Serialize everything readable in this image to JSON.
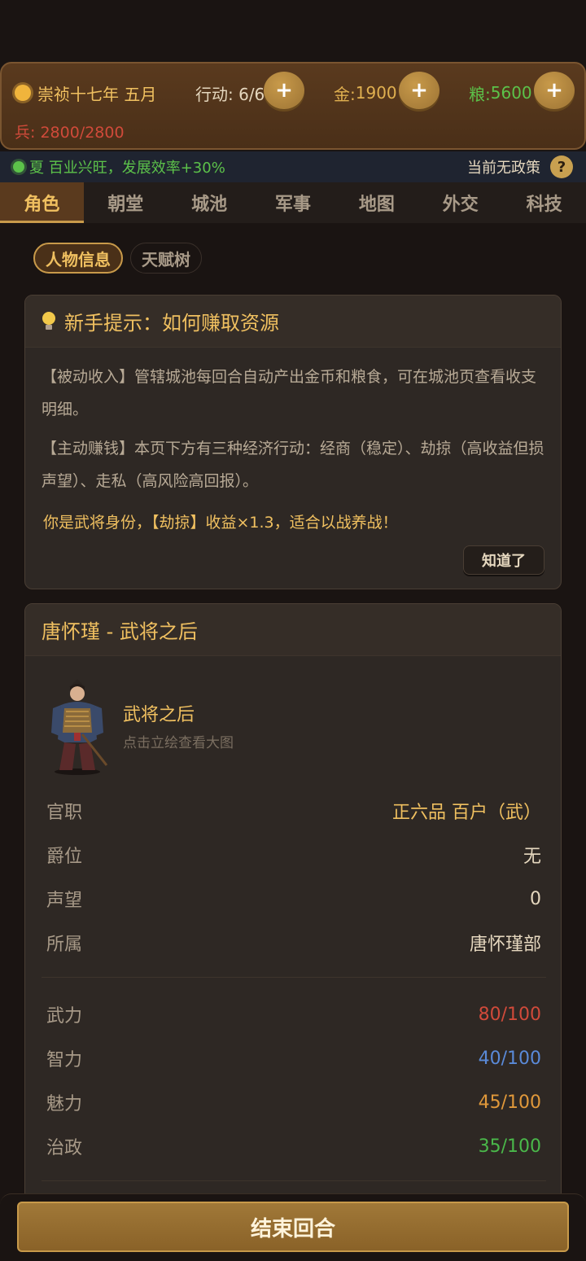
{
  "resources": {
    "date": "崇祯十七年 五月",
    "actions": "行动: 6/6",
    "gold_label": "金: ",
    "gold_value": "1900",
    "grain_label": "粮: ",
    "grain_value": "5600",
    "plus": "+",
    "soldiers": "兵: 2800/2800"
  },
  "season": {
    "text": "夏 百业兴旺，发展效率+30%",
    "policy": "当前无政策",
    "help": "?"
  },
  "tabs": [
    {
      "label": "角色"
    },
    {
      "label": "朝堂"
    },
    {
      "label": "城池"
    },
    {
      "label": "军事"
    },
    {
      "label": "地图"
    },
    {
      "label": "外交"
    },
    {
      "label": "科技"
    }
  ],
  "subtabs": [
    "人物信息",
    "天赋树"
  ],
  "tip": {
    "title": "新手提示：如何赚取资源",
    "para1": "【被动收入】管辖城池每回合自动产出金币和粮食，可在城池页查看收支明细。",
    "para2": "【主动赚钱】本页下方有三种经济行动：经商（稳定）、劫掠（高收益但损声望）、走私（高风险高回报）。",
    "highlight": "你是武将身份，【劫掠】收益×1.3，适合以战养战！",
    "button": "知道了"
  },
  "character": {
    "header": "唐怀瑾 - 武将之后",
    "name": "武将之后",
    "hint": "点击立绘查看大图",
    "info": [
      {
        "label": "官职",
        "value": "正六品 百户（武）"
      },
      {
        "label": "爵位",
        "value": "无"
      },
      {
        "label": "声望",
        "value": "0"
      },
      {
        "label": "所属",
        "value": "唐怀瑾部"
      }
    ],
    "stats": [
      {
        "label": "武力",
        "value": "80/100",
        "color": "#d04a3a"
      },
      {
        "label": "智力",
        "value": "40/100",
        "color": "#5a8ad8"
      },
      {
        "label": "魅力",
        "value": "45/100",
        "color": "#e0983a"
      },
      {
        "label": "治政",
        "value": "35/100",
        "color": "#4ab84a"
      }
    ]
  },
  "end_turn": "结束回合"
}
